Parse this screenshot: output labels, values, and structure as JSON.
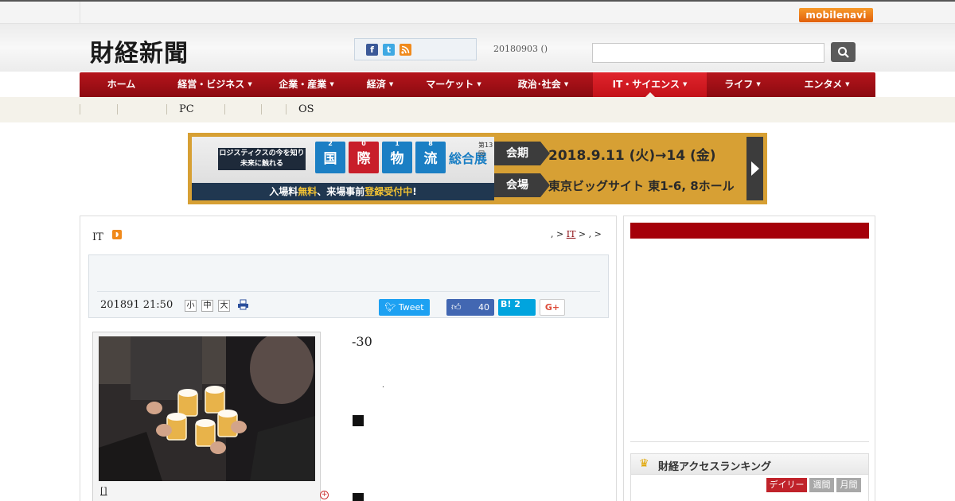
{
  "topbar": {
    "mobile_link": "mobilenavi"
  },
  "header": {
    "logo": "財経新聞",
    "date": "20180903 ()",
    "social": {
      "facebook": "f",
      "twitter": "t",
      "rss": "rss"
    },
    "search": {
      "placeholder": ""
    }
  },
  "nav": {
    "items": [
      {
        "label": "ホーム",
        "dropdown": false
      },
      {
        "label": "経営・ビジネス",
        "dropdown": true
      },
      {
        "label": "企業・産業",
        "dropdown": true
      },
      {
        "label": "経済",
        "dropdown": true
      },
      {
        "label": "マーケット",
        "dropdown": true
      },
      {
        "label": "政治･社会",
        "dropdown": true
      },
      {
        "label": "IT・サイエンス",
        "dropdown": true,
        "active": true
      },
      {
        "label": "ライフ",
        "dropdown": true
      },
      {
        "label": "エンタメ",
        "dropdown": true
      }
    ],
    "caret": "▼"
  },
  "subnav": {
    "items": [
      "PC",
      "OS"
    ]
  },
  "banner": {
    "tag": "ロジスティクスの今を知り未来に触れる",
    "cubes": [
      {
        "num": "2",
        "char": "国"
      },
      {
        "num": "0",
        "char": "際"
      },
      {
        "num": "1",
        "char": "物"
      },
      {
        "num": "8",
        "char": "流"
      }
    ],
    "title_rest": "総合展",
    "edition": "第13回",
    "free_pre": "入場料",
    "free_hl": "無料",
    "free_mid": "、来場事前",
    "free_hl2": "登録受付中",
    "free_post": "!",
    "period_label": "会期",
    "period_value": "2018.9.11 (火)→14 (金)",
    "venue_label": "会場",
    "venue_value": "東京ビッグサイト 東1-6, 8ホール"
  },
  "article": {
    "category": "IT",
    "breadcrumb_pre": ", > ",
    "breadcrumb_link": "IT",
    "breadcrumb_post": " > , >",
    "pubdate": "201891 21:50",
    "font_sizes": [
      "小",
      "中",
      "大"
    ],
    "tweet": "Tweet",
    "like_count": "40",
    "hatena": "B! 2",
    "gplus": "G+",
    "caption": "[]",
    "lead": "-30",
    "dot": "."
  },
  "sidebar": {
    "ranking_title": "財経アクセスランキング",
    "tabs": [
      "デイリー",
      "週間",
      "月間"
    ]
  }
}
